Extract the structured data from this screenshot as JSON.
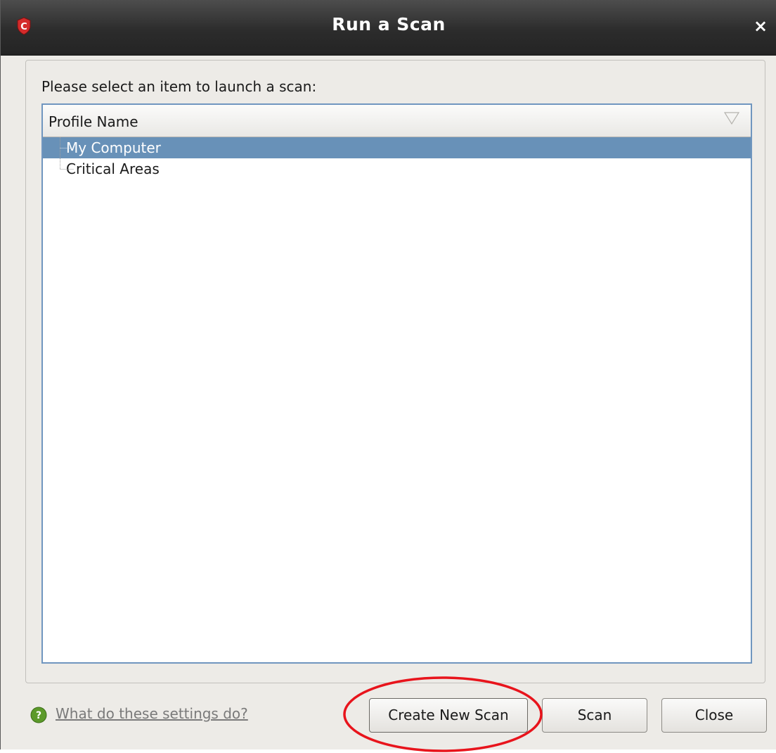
{
  "window": {
    "title": "Run a Scan",
    "close_glyph": "×",
    "logo_letter": "C"
  },
  "main": {
    "prompt": "Please select an item to launch a scan:",
    "list": {
      "header": "Profile Name",
      "items": [
        {
          "label": "My Computer",
          "selected": true
        },
        {
          "label": "Critical Areas",
          "selected": false
        }
      ]
    }
  },
  "footer": {
    "help_link": "What do these settings do?",
    "buttons": {
      "create": "Create New Scan",
      "scan": "Scan",
      "close": "Close"
    }
  },
  "colors": {
    "titlebar": "#2c2c2c",
    "selection": "#6891b8",
    "logo_red": "#d42b2b",
    "highlight_ellipse": "#e8141c",
    "help_icon": "#5c9a2a"
  },
  "icons": {
    "logo": "comodo-logo-icon",
    "close": "close-icon",
    "sort": "sort-arrow-icon",
    "help": "help-icon"
  }
}
